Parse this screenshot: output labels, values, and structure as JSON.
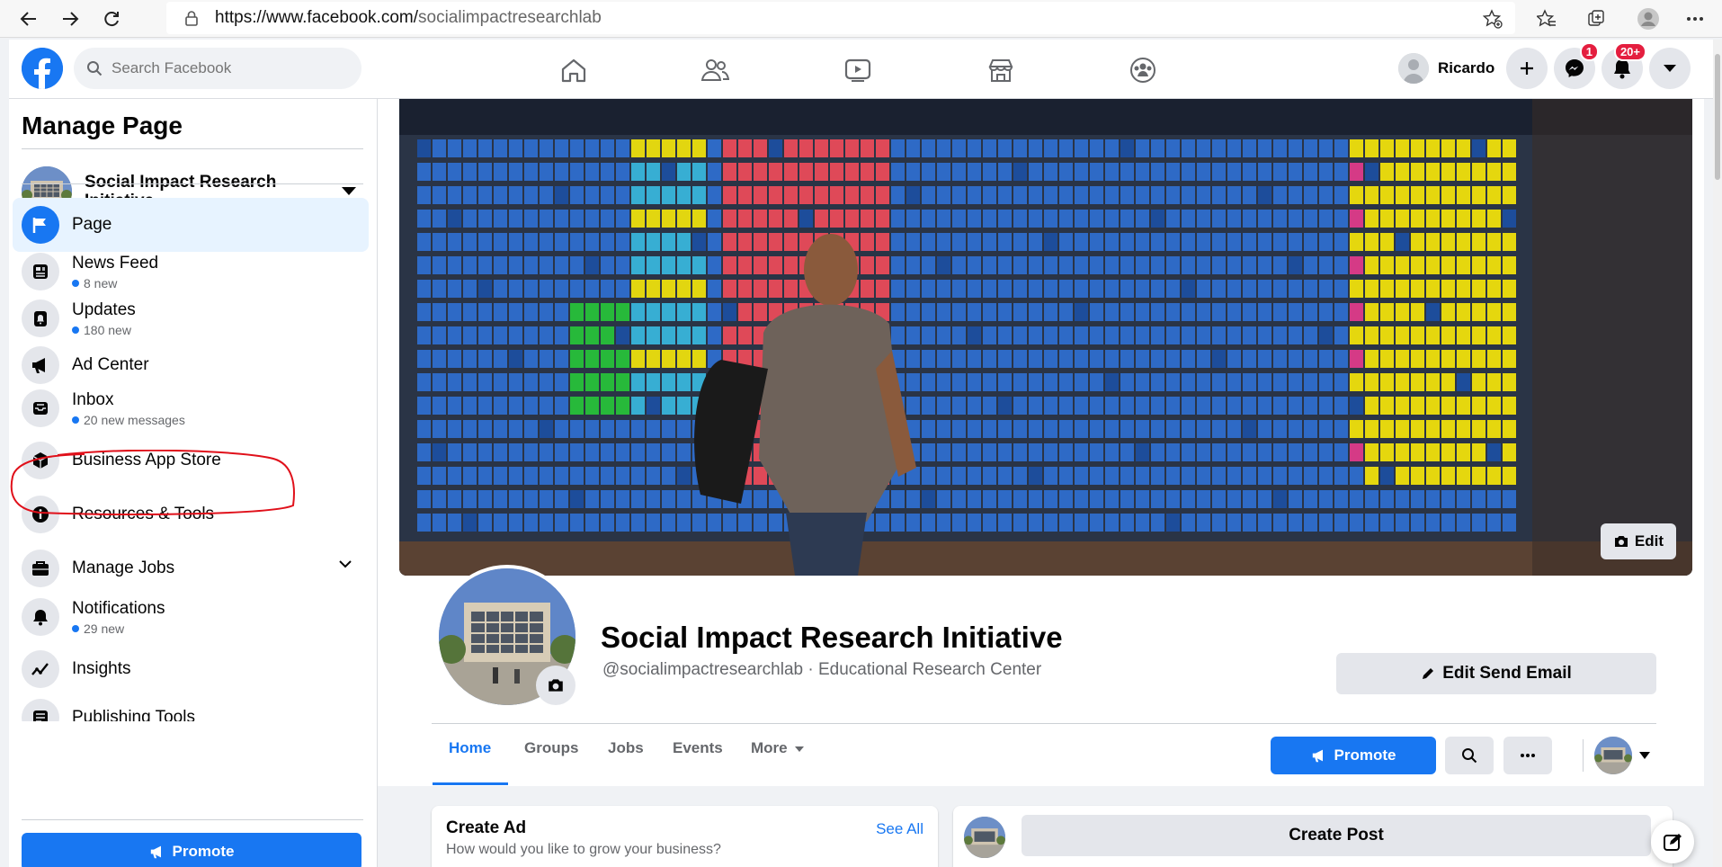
{
  "browser": {
    "url_host": "https://www.facebook.com/",
    "url_path": "socialimpactresearchlab"
  },
  "topbar": {
    "search_placeholder": "Search Facebook",
    "user_name": "Ricardo",
    "messenger_badge": "1",
    "notifications_badge": "20+"
  },
  "sidebar": {
    "title": "Manage Page",
    "page_name": "Social Impact Research Initiative",
    "items": [
      {
        "label": "Page"
      },
      {
        "label": "News Feed",
        "sub": "8 new"
      },
      {
        "label": "Updates",
        "sub": "180 new"
      },
      {
        "label": "Ad Center"
      },
      {
        "label": "Inbox",
        "sub": "20 new messages"
      },
      {
        "label": "Business App Store"
      },
      {
        "label": "Resources & Tools"
      },
      {
        "label": "Manage Jobs"
      },
      {
        "label": "Notifications",
        "sub": "29 new"
      },
      {
        "label": "Insights"
      },
      {
        "label": "Publishing Tools"
      }
    ],
    "promote_label": "Promote"
  },
  "page": {
    "name": "Social Impact Research Initiative",
    "handle": "@socialimpactresearchlab · Educational Research Center",
    "edit_cover_label": "Edit",
    "send_email_label": "Edit Send Email",
    "tabs": [
      "Home",
      "Groups",
      "Jobs",
      "Events",
      "More"
    ],
    "promote_label": "Promote"
  },
  "cards": {
    "create_ad_title": "Create Ad",
    "create_ad_sub": "How would you like to grow your business?",
    "see_all": "See All",
    "create_post": "Create Post"
  },
  "colors": {
    "brand": "#1877f2",
    "badge": "#e41e3f",
    "annotation": "#e0101a"
  }
}
